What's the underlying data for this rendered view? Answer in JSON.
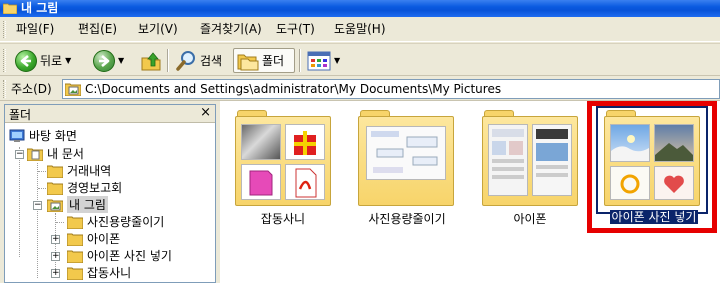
{
  "window": {
    "title": "내 그림"
  },
  "menu": [
    {
      "label": "파일(F)"
    },
    {
      "label": "편집(E)"
    },
    {
      "label": "보기(V)"
    },
    {
      "label": "즐겨찾기(A)"
    },
    {
      "label": "도구(T)"
    },
    {
      "label": "도움말(H)"
    }
  ],
  "toolbar": {
    "back_label": "뒤로",
    "search_label": "검색",
    "folders_label": "폴더"
  },
  "address": {
    "label": "주소(D)",
    "value": "C:\\Documents and Settings\\administrator\\My Documents\\My Pictures"
  },
  "folder_pane": {
    "title": "폴더",
    "close_glyph": "×",
    "tree": [
      {
        "label": "바탕 화면"
      },
      {
        "label": "내 문서"
      },
      {
        "label": "거래내역"
      },
      {
        "label": "경영보고회"
      },
      {
        "label": "내 그림"
      },
      {
        "label": "사진용량줄이기"
      },
      {
        "label": "아이폰"
      },
      {
        "label": "아이폰 사진 넣기"
      },
      {
        "label": "잡동사니"
      }
    ]
  },
  "items": [
    {
      "label": "잡동사니"
    },
    {
      "label": "사진용량줄이기"
    },
    {
      "label": "아이폰"
    },
    {
      "label": "아이폰 사진 넣기",
      "selected": true
    }
  ],
  "colors": {
    "highlight_frame": "#e60000",
    "selection": "#0a246a"
  }
}
